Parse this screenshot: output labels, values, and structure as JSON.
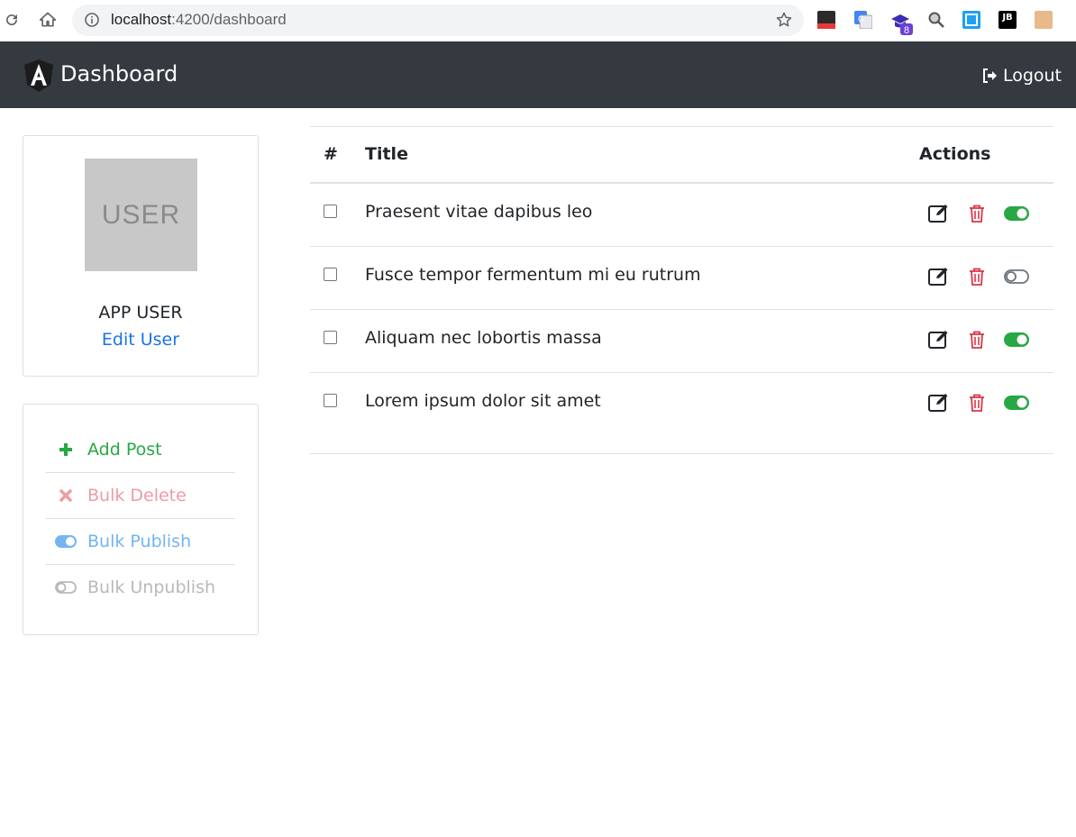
{
  "browser": {
    "url_host": "localhost",
    "url_path": ":4200/dashboard"
  },
  "navbar": {
    "brand_title": "Dashboard",
    "logout_label": "Logout"
  },
  "user_card": {
    "avatar_text": "USER",
    "name": "APP USER",
    "edit_label": "Edit User"
  },
  "actions": {
    "add_post": "Add Post",
    "bulk_delete": "Bulk Delete",
    "bulk_publish": "Bulk Publish",
    "bulk_unpublish": "Bulk Unpublish"
  },
  "table": {
    "headers": {
      "num": "#",
      "title": "Title",
      "actions": "Actions"
    },
    "rows": [
      {
        "title": "Praesent vitae dapibus leo",
        "published": true
      },
      {
        "title": "Fusce tempor fermentum mi eu rutrum",
        "published": false
      },
      {
        "title": "Aliquam nec lobortis massa",
        "published": true
      },
      {
        "title": "Lorem ipsum dolor sit amet",
        "published": true
      }
    ]
  },
  "colors": {
    "navbar": "#343a40",
    "success": "#28a745",
    "danger": "#dc3545",
    "link": "#1a73e8"
  }
}
